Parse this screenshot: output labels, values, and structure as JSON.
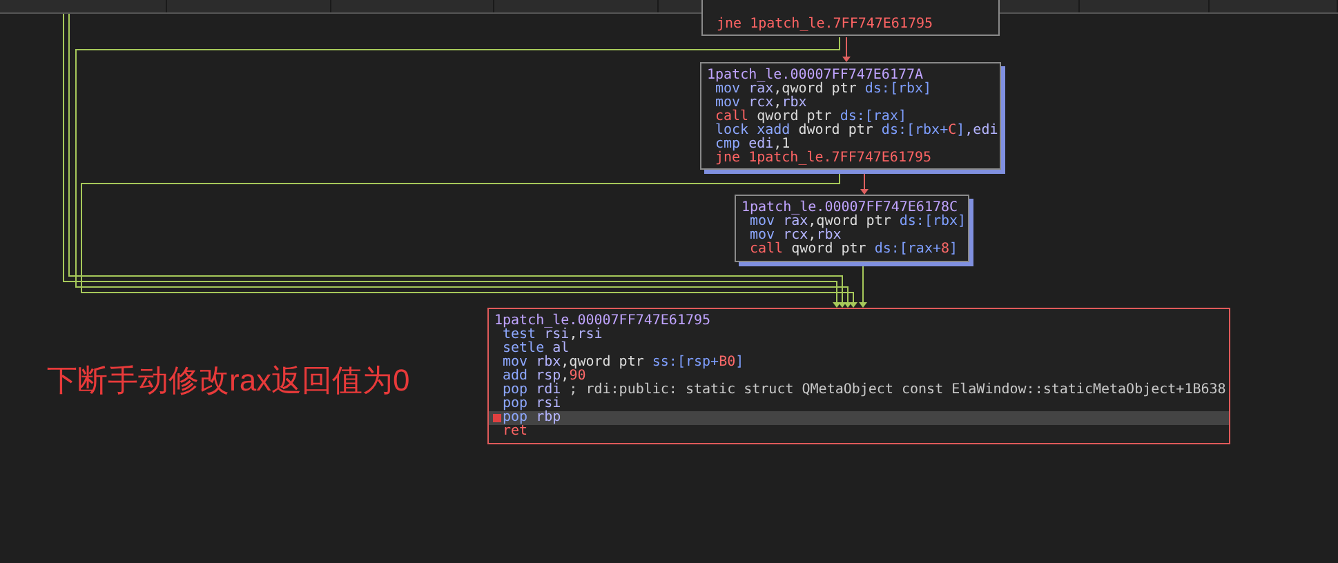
{
  "blocks": [
    {
      "kind": "plain",
      "lines": [
        {
          "selected": false,
          "breakpoint": false,
          "parts": [
            {
              "text": "jne",
              "kind": "branch"
            },
            {
              "text": " 1patch_le.7FF747E61795",
              "kind": "branch"
            }
          ]
        }
      ]
    },
    {
      "kind": "shadowed",
      "lines": [
        {
          "selected": false,
          "breakpoint": false,
          "parts": [
            {
              "text": "1patch_le.00007FF747E6177A",
              "kind": "label"
            }
          ]
        },
        {
          "selected": false,
          "breakpoint": false,
          "parts": [
            {
              "text": "mov",
              "kind": "mnem"
            },
            {
              "text": " rax",
              "kind": "reg"
            },
            {
              "text": ",qword ptr ",
              "kind": "plain"
            },
            {
              "text": "ds:[rbx]",
              "kind": "seg"
            }
          ]
        },
        {
          "selected": false,
          "breakpoint": false,
          "parts": [
            {
              "text": "mov",
              "kind": "mnem"
            },
            {
              "text": " rcx",
              "kind": "reg"
            },
            {
              "text": ",",
              "kind": "plain"
            },
            {
              "text": "rbx",
              "kind": "reg"
            }
          ]
        },
        {
          "selected": false,
          "breakpoint": false,
          "parts": [
            {
              "text": "call",
              "kind": "branch"
            },
            {
              "text": " qword ptr ",
              "kind": "plain"
            },
            {
              "text": "ds:[rax]",
              "kind": "seg"
            }
          ]
        },
        {
          "selected": false,
          "breakpoint": false,
          "parts": [
            {
              "text": "lock xadd",
              "kind": "mnem"
            },
            {
              "text": " dword ptr ",
              "kind": "plain"
            },
            {
              "text": "ds:[rbx+",
              "kind": "seg"
            },
            {
              "text": "C",
              "kind": "num"
            },
            {
              "text": "]",
              "kind": "seg"
            },
            {
              "text": ",edi",
              "kind": "reg"
            }
          ]
        },
        {
          "selected": false,
          "breakpoint": false,
          "parts": [
            {
              "text": "cmp",
              "kind": "mnem"
            },
            {
              "text": " edi",
              "kind": "reg"
            },
            {
              "text": ",1",
              "kind": "plain"
            }
          ]
        },
        {
          "selected": false,
          "breakpoint": false,
          "parts": [
            {
              "text": "jne",
              "kind": "branch"
            },
            {
              "text": " 1patch_le.7FF747E61795",
              "kind": "branch"
            }
          ]
        }
      ]
    },
    {
      "kind": "shadowed",
      "lines": [
        {
          "selected": false,
          "breakpoint": false,
          "parts": [
            {
              "text": "1patch_le.00007FF747E6178C",
              "kind": "label"
            }
          ]
        },
        {
          "selected": false,
          "breakpoint": false,
          "parts": [
            {
              "text": "mov",
              "kind": "mnem"
            },
            {
              "text": " rax",
              "kind": "reg"
            },
            {
              "text": ",qword ptr ",
              "kind": "plain"
            },
            {
              "text": "ds:[rbx]",
              "kind": "seg"
            }
          ]
        },
        {
          "selected": false,
          "breakpoint": false,
          "parts": [
            {
              "text": "mov",
              "kind": "mnem"
            },
            {
              "text": " rcx",
              "kind": "reg"
            },
            {
              "text": ",",
              "kind": "plain"
            },
            {
              "text": "rbx",
              "kind": "reg"
            }
          ]
        },
        {
          "selected": false,
          "breakpoint": false,
          "parts": [
            {
              "text": "call",
              "kind": "branch"
            },
            {
              "text": " qword ptr ",
              "kind": "plain"
            },
            {
              "text": "ds:[rax+",
              "kind": "seg"
            },
            {
              "text": "8",
              "kind": "num"
            },
            {
              "text": "]",
              "kind": "seg"
            }
          ]
        }
      ]
    },
    {
      "kind": "current",
      "lines": [
        {
          "selected": false,
          "breakpoint": false,
          "parts": [
            {
              "text": "1patch_le.00007FF747E61795",
              "kind": "label"
            }
          ]
        },
        {
          "selected": false,
          "breakpoint": false,
          "parts": [
            {
              "text": "test",
              "kind": "mnem"
            },
            {
              "text": " rsi",
              "kind": "reg"
            },
            {
              "text": ",",
              "kind": "plain"
            },
            {
              "text": "rsi",
              "kind": "reg"
            }
          ]
        },
        {
          "selected": false,
          "breakpoint": false,
          "parts": [
            {
              "text": "setle",
              "kind": "mnem"
            },
            {
              "text": " al",
              "kind": "reg"
            }
          ]
        },
        {
          "selected": false,
          "breakpoint": false,
          "parts": [
            {
              "text": "mov",
              "kind": "mnem"
            },
            {
              "text": " rbx",
              "kind": "reg"
            },
            {
              "text": ",qword ptr ",
              "kind": "plain"
            },
            {
              "text": "ss:[rsp+",
              "kind": "seg"
            },
            {
              "text": "B0",
              "kind": "num"
            },
            {
              "text": "]",
              "kind": "seg"
            }
          ]
        },
        {
          "selected": false,
          "breakpoint": false,
          "parts": [
            {
              "text": "add",
              "kind": "mnem"
            },
            {
              "text": " rsp",
              "kind": "reg"
            },
            {
              "text": ",",
              "kind": "plain"
            },
            {
              "text": "90",
              "kind": "num"
            }
          ]
        },
        {
          "selected": false,
          "breakpoint": false,
          "parts": [
            {
              "text": "pop",
              "kind": "mnem"
            },
            {
              "text": " rdi",
              "kind": "reg"
            },
            {
              "text": " ; rdi:public: static struct QMetaObject const ElaWindow::staticMetaObject+1B638",
              "kind": "comment"
            }
          ]
        },
        {
          "selected": false,
          "breakpoint": false,
          "parts": [
            {
              "text": "pop",
              "kind": "mnem"
            },
            {
              "text": " rsi",
              "kind": "reg"
            }
          ]
        },
        {
          "selected": true,
          "breakpoint": true,
          "parts": [
            {
              "text": "pop",
              "kind": "mnem"
            },
            {
              "text": " rbp",
              "kind": "reg"
            }
          ]
        },
        {
          "selected": false,
          "breakpoint": false,
          "parts": [
            {
              "text": "ret",
              "kind": "branch"
            }
          ]
        }
      ]
    }
  ],
  "annotation": "下断手动修改rax返回值为0"
}
